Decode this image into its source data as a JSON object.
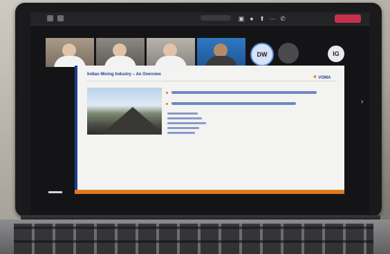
{
  "scene": {
    "description_colors": {
      "accent_blue": "#1d3f8f",
      "accent_orange": "#e07b1a",
      "leave_red": "#c4314b"
    }
  },
  "meeting": {
    "toolbar_icons": [
      "camera-icon",
      "mic-icon",
      "share-icon",
      "more-icon",
      "phone-icon"
    ],
    "participants": [
      {
        "type": "video",
        "icon": "person-video"
      },
      {
        "type": "video",
        "icon": "person-video"
      },
      {
        "type": "video",
        "icon": "person-video"
      },
      {
        "type": "video",
        "icon": "person-video"
      },
      {
        "type": "avatar",
        "initials": "DW"
      },
      {
        "type": "avatar",
        "initials": ""
      },
      {
        "type": "avatar",
        "initials": "IG"
      }
    ]
  },
  "slide": {
    "title": "Indian Mining Industry – An Overview",
    "logo_text": "VOMA"
  }
}
